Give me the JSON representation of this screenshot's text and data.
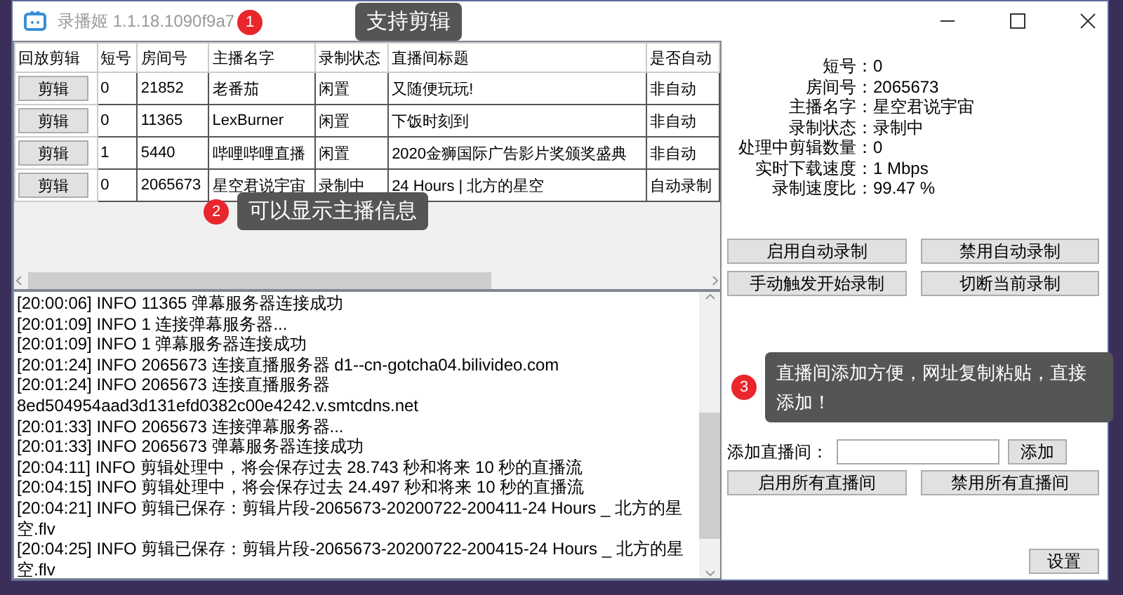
{
  "window": {
    "title": "录播姬 1.1.18.1090f9a7"
  },
  "callouts": [
    {
      "number": "1",
      "text": "支持剪辑"
    },
    {
      "number": "2",
      "text": "可以显示主播信息"
    },
    {
      "number": "3",
      "text": "直播间添加方便，网址复制粘贴，直接添加！"
    }
  ],
  "table": {
    "columns": [
      "回放剪辑",
      "短号",
      "房间号",
      "主播名字",
      "录制状态",
      "直播间标题",
      "是否自动"
    ],
    "rows": [
      {
        "cells": [
          "剪辑",
          "0",
          "21852",
          "老番茄",
          "闲置",
          "又随便玩玩!",
          "非自动"
        ]
      },
      {
        "cells": [
          "剪辑",
          "0",
          "11365",
          "LexBurner",
          "闲置",
          "下饭时刻到",
          "非自动"
        ]
      },
      {
        "cells": [
          "剪辑",
          "1",
          "5440",
          "哔哩哔哩直播",
          "闲置",
          "2020金狮国际广告影片奖颁奖盛典",
          "非自动"
        ]
      },
      {
        "cells": [
          "剪辑",
          "0",
          "2065673",
          "星空君说宇宙",
          "录制中",
          "24 Hours | 北方的星空",
          "自动录制"
        ]
      }
    ]
  },
  "log": [
    "[20:00:06] INFO 11365 弹幕服务器连接成功",
    "[20:01:09] INFO 1 连接弹幕服务器...",
    "[20:01:09] INFO 1 弹幕服务器连接成功",
    "[20:01:24] INFO 2065673 连接直播服务器 d1--cn-gotcha04.bilivideo.com",
    "[20:01:24] INFO 2065673 连接直播服务器 8ed504954aad3d131efd0382c00e4242.v.smtcdns.net",
    "[20:01:33] INFO 2065673 连接弹幕服务器...",
    "[20:01:33] INFO 2065673 弹幕服务器连接成功",
    "[20:04:11] INFO  剪辑处理中，将会保存过去 28.743 秒和将来 10 秒的直播流",
    "[20:04:15] INFO  剪辑处理中，将会保存过去 24.497 秒和将来 10 秒的直播流",
    "[20:04:21] INFO  剪辑已保存：剪辑片段-2065673-20200722-200411-24 Hours _ 北方的星空.flv",
    "[20:04:25] INFO  剪辑已保存：剪辑片段-2065673-20200722-200415-24 Hours _ 北方的星空.flv"
  ],
  "details": [
    {
      "label": "短号：",
      "value": "0"
    },
    {
      "label": "房间号：",
      "value": "2065673"
    },
    {
      "label": "主播名字：",
      "value": "星空君说宇宙"
    },
    {
      "label": "录制状态：",
      "value": "录制中"
    },
    {
      "label": "处理中剪辑数量：",
      "value": "0"
    },
    {
      "label": "实时下载速度：",
      "value": "1 Mbps"
    },
    {
      "label": "录制速度比：",
      "value": "99.47 %"
    }
  ],
  "record_buttons": [
    "启用自动录制",
    "禁用自动录制",
    "手动触发开始录制",
    "切断当前录制"
  ],
  "add_room": {
    "label": "添加直播间：",
    "button": "添加"
  },
  "room_buttons": [
    "启用所有直播间",
    "禁用所有直播间"
  ],
  "settings_button": "设置"
}
